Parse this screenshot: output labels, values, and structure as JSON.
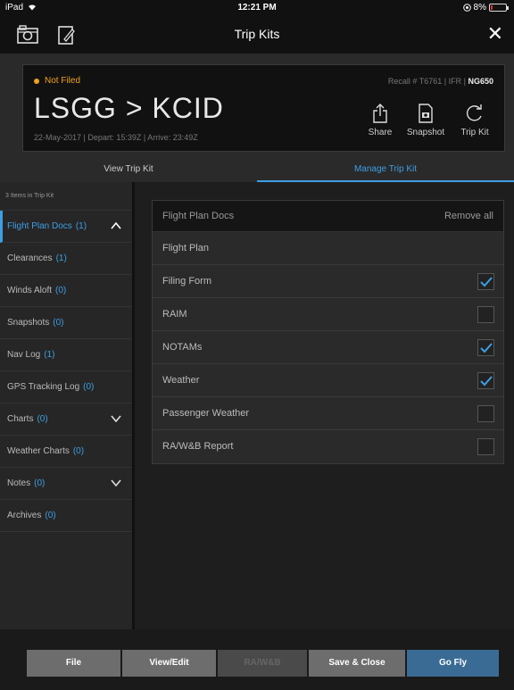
{
  "status_bar": {
    "device": "iPad",
    "time": "12:21 PM",
    "battery": "8%",
    "battery_level": 0.08
  },
  "nav": {
    "title": "Trip Kits",
    "close_symbol": "✕"
  },
  "trip": {
    "status": "Not Filed",
    "status_color": "#f0a020",
    "recall_prefix": "Recall # T6761 | IFR |",
    "aircraft": "NG650",
    "route": "LSGG > KCID",
    "datetime": "22-May-2017 | Depart: 15:39Z | Arrive: 23:49Z",
    "actions": [
      {
        "label": "Share",
        "icon": "share-icon"
      },
      {
        "label": "Snapshot",
        "icon": "snapshot-icon"
      },
      {
        "label": "Trip Kit",
        "icon": "refresh-icon"
      }
    ]
  },
  "tabs": {
    "view": "View Trip Kit",
    "manage": "Manage Trip Kit",
    "accent": "#3d9ee3"
  },
  "sidebar": {
    "header": "3 Items in Trip Kit",
    "items": [
      {
        "label": "Flight Plan Docs",
        "count": "(1)",
        "active": true,
        "chevron": "up"
      },
      {
        "label": "Clearances",
        "count": "(1)"
      },
      {
        "label": "Winds Aloft",
        "count": "(0)"
      },
      {
        "label": "Snapshots",
        "count": "(0)"
      },
      {
        "label": "Nav Log",
        "count": "(1)"
      },
      {
        "label": "GPS Tracking Log",
        "count": "(0)"
      },
      {
        "label": "Charts",
        "count": "(0)",
        "chevron": "down"
      },
      {
        "label": "Weather Charts",
        "count": "(0)"
      },
      {
        "label": "Notes",
        "count": "(0)",
        "chevron": "down"
      },
      {
        "label": "Archives",
        "count": "(0)"
      }
    ]
  },
  "docs": {
    "header": "Flight Plan Docs",
    "remove_all": "Remove all",
    "rows": [
      {
        "label": "Flight Plan",
        "checkbox": false
      },
      {
        "label": "Filing Form",
        "checkbox": true,
        "checked": true
      },
      {
        "label": "RAIM",
        "checkbox": true,
        "checked": false
      },
      {
        "label": "NOTAMs",
        "checkbox": true,
        "checked": true
      },
      {
        "label": "Weather",
        "checkbox": true,
        "checked": true
      },
      {
        "label": "Passenger Weather",
        "checkbox": true,
        "checked": false
      },
      {
        "label": "RA/W&B Report",
        "checkbox": true,
        "checked": false
      }
    ]
  },
  "footer": {
    "file": "File",
    "view_edit": "View/Edit",
    "ra_wb": "RA/W&B",
    "save_close": "Save & Close",
    "go_fly": "Go Fly"
  }
}
